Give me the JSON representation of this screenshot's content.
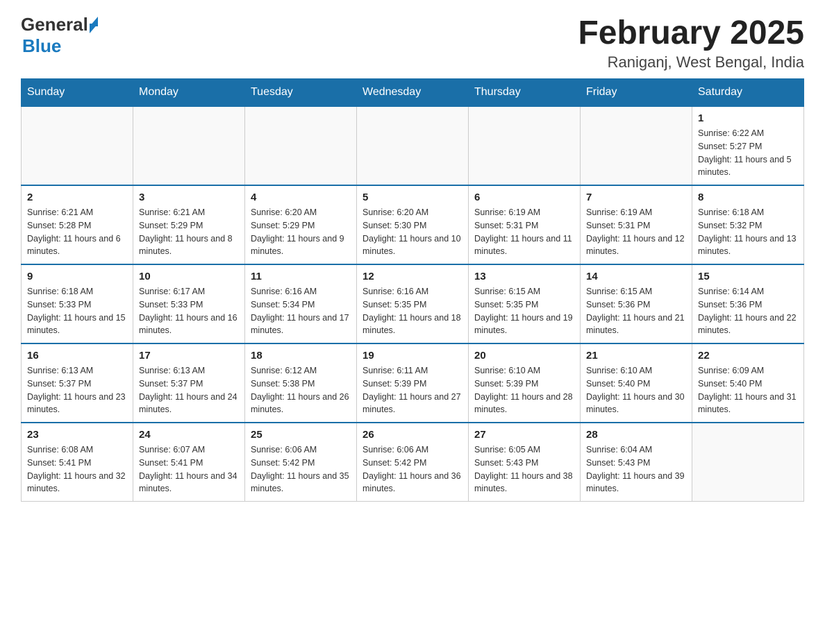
{
  "header": {
    "logo": {
      "text_general": "General",
      "text_blue": "Blue",
      "arrow": "▶"
    },
    "title": "February 2025",
    "location": "Raniganj, West Bengal, India"
  },
  "weekdays": [
    "Sunday",
    "Monday",
    "Tuesday",
    "Wednesday",
    "Thursday",
    "Friday",
    "Saturday"
  ],
  "weeks": [
    [
      {
        "day": "",
        "info": ""
      },
      {
        "day": "",
        "info": ""
      },
      {
        "day": "",
        "info": ""
      },
      {
        "day": "",
        "info": ""
      },
      {
        "day": "",
        "info": ""
      },
      {
        "day": "",
        "info": ""
      },
      {
        "day": "1",
        "info": "Sunrise: 6:22 AM\nSunset: 5:27 PM\nDaylight: 11 hours and 5 minutes."
      }
    ],
    [
      {
        "day": "2",
        "info": "Sunrise: 6:21 AM\nSunset: 5:28 PM\nDaylight: 11 hours and 6 minutes."
      },
      {
        "day": "3",
        "info": "Sunrise: 6:21 AM\nSunset: 5:29 PM\nDaylight: 11 hours and 8 minutes."
      },
      {
        "day": "4",
        "info": "Sunrise: 6:20 AM\nSunset: 5:29 PM\nDaylight: 11 hours and 9 minutes."
      },
      {
        "day": "5",
        "info": "Sunrise: 6:20 AM\nSunset: 5:30 PM\nDaylight: 11 hours and 10 minutes."
      },
      {
        "day": "6",
        "info": "Sunrise: 6:19 AM\nSunset: 5:31 PM\nDaylight: 11 hours and 11 minutes."
      },
      {
        "day": "7",
        "info": "Sunrise: 6:19 AM\nSunset: 5:31 PM\nDaylight: 11 hours and 12 minutes."
      },
      {
        "day": "8",
        "info": "Sunrise: 6:18 AM\nSunset: 5:32 PM\nDaylight: 11 hours and 13 minutes."
      }
    ],
    [
      {
        "day": "9",
        "info": "Sunrise: 6:18 AM\nSunset: 5:33 PM\nDaylight: 11 hours and 15 minutes."
      },
      {
        "day": "10",
        "info": "Sunrise: 6:17 AM\nSunset: 5:33 PM\nDaylight: 11 hours and 16 minutes."
      },
      {
        "day": "11",
        "info": "Sunrise: 6:16 AM\nSunset: 5:34 PM\nDaylight: 11 hours and 17 minutes."
      },
      {
        "day": "12",
        "info": "Sunrise: 6:16 AM\nSunset: 5:35 PM\nDaylight: 11 hours and 18 minutes."
      },
      {
        "day": "13",
        "info": "Sunrise: 6:15 AM\nSunset: 5:35 PM\nDaylight: 11 hours and 19 minutes."
      },
      {
        "day": "14",
        "info": "Sunrise: 6:15 AM\nSunset: 5:36 PM\nDaylight: 11 hours and 21 minutes."
      },
      {
        "day": "15",
        "info": "Sunrise: 6:14 AM\nSunset: 5:36 PM\nDaylight: 11 hours and 22 minutes."
      }
    ],
    [
      {
        "day": "16",
        "info": "Sunrise: 6:13 AM\nSunset: 5:37 PM\nDaylight: 11 hours and 23 minutes."
      },
      {
        "day": "17",
        "info": "Sunrise: 6:13 AM\nSunset: 5:37 PM\nDaylight: 11 hours and 24 minutes."
      },
      {
        "day": "18",
        "info": "Sunrise: 6:12 AM\nSunset: 5:38 PM\nDaylight: 11 hours and 26 minutes."
      },
      {
        "day": "19",
        "info": "Sunrise: 6:11 AM\nSunset: 5:39 PM\nDaylight: 11 hours and 27 minutes."
      },
      {
        "day": "20",
        "info": "Sunrise: 6:10 AM\nSunset: 5:39 PM\nDaylight: 11 hours and 28 minutes."
      },
      {
        "day": "21",
        "info": "Sunrise: 6:10 AM\nSunset: 5:40 PM\nDaylight: 11 hours and 30 minutes."
      },
      {
        "day": "22",
        "info": "Sunrise: 6:09 AM\nSunset: 5:40 PM\nDaylight: 11 hours and 31 minutes."
      }
    ],
    [
      {
        "day": "23",
        "info": "Sunrise: 6:08 AM\nSunset: 5:41 PM\nDaylight: 11 hours and 32 minutes."
      },
      {
        "day": "24",
        "info": "Sunrise: 6:07 AM\nSunset: 5:41 PM\nDaylight: 11 hours and 34 minutes."
      },
      {
        "day": "25",
        "info": "Sunrise: 6:06 AM\nSunset: 5:42 PM\nDaylight: 11 hours and 35 minutes."
      },
      {
        "day": "26",
        "info": "Sunrise: 6:06 AM\nSunset: 5:42 PM\nDaylight: 11 hours and 36 minutes."
      },
      {
        "day": "27",
        "info": "Sunrise: 6:05 AM\nSunset: 5:43 PM\nDaylight: 11 hours and 38 minutes."
      },
      {
        "day": "28",
        "info": "Sunrise: 6:04 AM\nSunset: 5:43 PM\nDaylight: 11 hours and 39 minutes."
      },
      {
        "day": "",
        "info": ""
      }
    ]
  ]
}
